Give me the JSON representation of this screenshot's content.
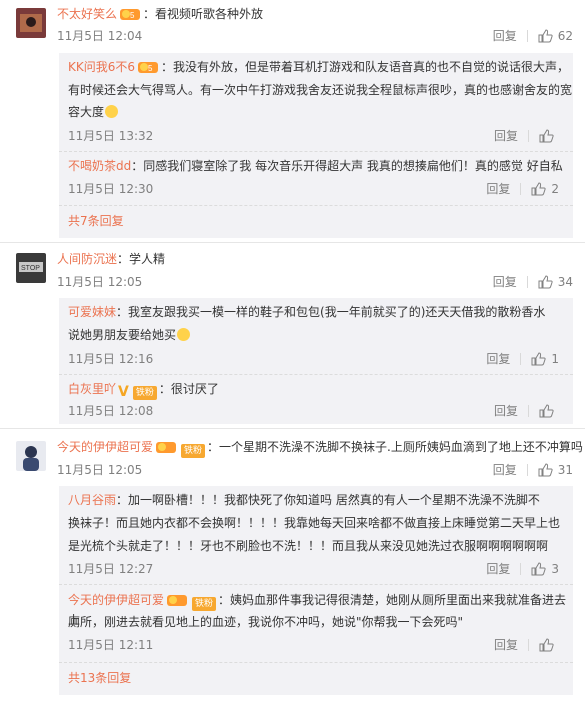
{
  "reply_label": "回复",
  "comments": [
    {
      "name": "不太好笑么",
      "text": "：看视频听歌各种外放",
      "time": "11月5日 12:04",
      "likes": "62",
      "subs": [
        {
          "name": "KK问我6不6",
          "text": "：我没有外放，但是带着耳机打游戏和队友语音真的也不自觉的说话很大声，",
          "text2": "有时候还会大气得骂人。有一次中午打游戏我舍友还说我全程鼠标声很吵，真的也感谢舍友的宽",
          "text3": "容大度",
          "time": "11月5日 13:32",
          "likes": ""
        },
        {
          "name": "不喝奶茶dd",
          "text": "：同感我们寝室除了我  每次音乐开得超大声 我真的想揍扁他们！真的感觉 好自私",
          "time": "11月5日 12:30",
          "likes": "2"
        }
      ],
      "more": "共7条回复"
    },
    {
      "name": "人间防沉迷",
      "text": "：学人精",
      "time": "11月5日 12:05",
      "likes": "34",
      "subs": [
        {
          "name": "可爱妹妹",
          "text": "：我室友跟我买一模一样的鞋子和包包(我一年前就买了的)还天天借我的散粉香水",
          "text2": "说她男朋友要给她买",
          "time": "11月5日 12:16",
          "likes": "1"
        },
        {
          "name": "白灰里吖",
          "badge": "V",
          "fan": "铁粉",
          "text": "：很讨厌了",
          "time": "11月5日 12:08",
          "likes": ""
        }
      ]
    },
    {
      "name": "今天的伊伊超可爱",
      "fan": "铁粉",
      "text": "：一个星期不洗澡不洗脚不换袜子.上厕所姨妈血滴到了地上还不冲算吗",
      "time": "11月5日 12:05",
      "likes": "31",
      "subs": [
        {
          "name": "八月谷雨",
          "text": "：加一啊卧槽！！！我都快死了你知道吗  居然真的有人一个星期不洗澡不洗脚不",
          "text2": "换袜子！而且她内衣都不会换啊！！！！我靠她每天回来啥都不做直接上床睡觉第二天早上也",
          "text3": "是光梳个头就走了！！！牙也不刷脸也不洗！！！而且我从来没见她洗过衣服啊啊啊啊啊啊",
          "time": "11月5日 12:27",
          "likes": "3"
        },
        {
          "name": "今天的伊伊超可爱",
          "fan": "铁粉",
          "text": "：姨妈血那件事我记得很清楚，她刚从厕所里面出来我就准备进去上",
          "text2": "厕所，刚进去就看见地上的血迹，我说你不冲吗，她说\"你帮我一下会死吗\"",
          "time": "11月5日 12:11",
          "likes": ""
        }
      ],
      "more": "共13条回复"
    }
  ]
}
